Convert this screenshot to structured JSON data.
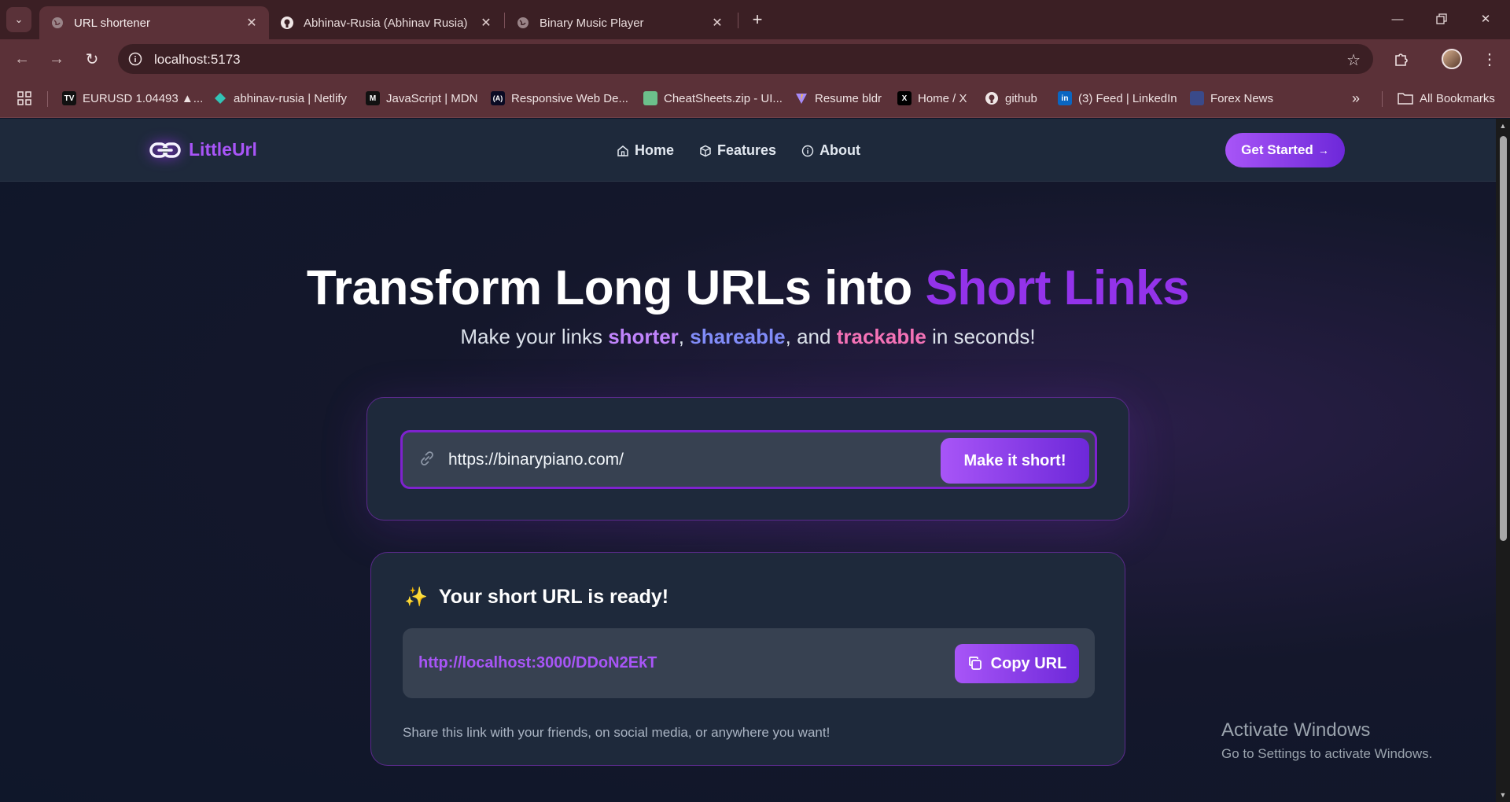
{
  "browser": {
    "tabs": [
      {
        "title": "URL shortener",
        "icon": "globe-icon",
        "active": true
      },
      {
        "title": "Abhinav-Rusia (Abhinav Rusia)",
        "icon": "github-icon",
        "active": false
      },
      {
        "title": "Binary Music Player",
        "icon": "globe-icon",
        "active": false
      }
    ],
    "address": "localhost:5173",
    "bookmarks": [
      {
        "label": "EURUSD 1.04493 ▲...",
        "icon": "tradingview-icon"
      },
      {
        "label": "abhinav-rusia | Netlify",
        "icon": "netlify-icon"
      },
      {
        "label": "JavaScript | MDN",
        "icon": "mdn-icon"
      },
      {
        "label": "Responsive Web De...",
        "icon": "freecodecamp-icon"
      },
      {
        "label": "CheatSheets.zip - UI...",
        "icon": "cheatsheets-icon"
      },
      {
        "label": "Resume bldr",
        "icon": "vite-icon"
      },
      {
        "label": "Home / X",
        "icon": "x-icon"
      },
      {
        "label": "github",
        "icon": "github-icon"
      },
      {
        "label": "(3) Feed | LinkedIn",
        "icon": "linkedin-icon"
      },
      {
        "label": "Forex News",
        "icon": "forex-icon"
      }
    ],
    "all_bookmarks": "All Bookmarks"
  },
  "site": {
    "logo": "LittleUrl",
    "nav": [
      {
        "label": "Home",
        "icon": "home-icon"
      },
      {
        "label": "Features",
        "icon": "box-icon"
      },
      {
        "label": "About",
        "icon": "info-icon"
      }
    ],
    "cta": "Get Started"
  },
  "hero": {
    "title_main": "Transform Long URLs into",
    "title_accent": "Short Links",
    "sub_prefix": "Make your links",
    "sub_w1": "shorter",
    "sub_comma": ",",
    "sub_w2": "shareable",
    "sub_and": ", and",
    "sub_w3": "trackable",
    "sub_suffix": "in seconds!"
  },
  "shortener": {
    "input_value": "https://binarypiano.com/",
    "button": "Make it short!"
  },
  "result": {
    "heading": "Your short URL is ready!",
    "short_url": "http://localhost:3000/DDoN2EkT",
    "copy_label": "Copy URL",
    "note": "Share this link with your friends, on social media, or anywhere you want!"
  },
  "watermark": {
    "line1": "Activate Windows",
    "line2": "Go to Settings to activate Windows."
  },
  "colors": {
    "accent": "#9333ea",
    "purple_word": "#c084fc",
    "blue_word": "#818cf8",
    "pink_word": "#f472b6",
    "browser_frame": "#5b3138"
  }
}
